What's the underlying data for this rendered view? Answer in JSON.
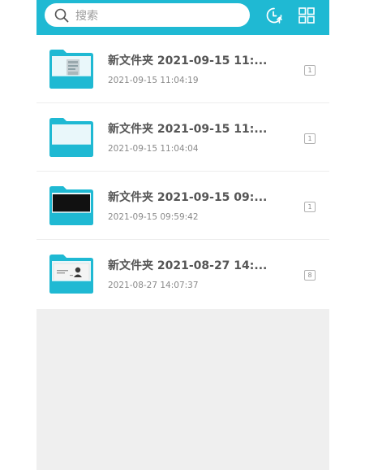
{
  "colors": {
    "accent": "#1fb9d3",
    "folder_light": "#e9f7fa",
    "background": "#efefef"
  },
  "header": {
    "search_placeholder": "搜索",
    "icons": [
      "search-icon",
      "clock-upload-icon",
      "grid-view-icon"
    ]
  },
  "folders": [
    {
      "title": "新文件夹 2021-09-15 11:...",
      "date": "2021-09-15 11:04:19",
      "count": "1",
      "thumbnail": "document-thumbnail"
    },
    {
      "title": "新文件夹 2021-09-15 11:...",
      "date": "2021-09-15 11:04:04",
      "count": "1",
      "thumbnail": "empty"
    },
    {
      "title": "新文件夹 2021-09-15 09:...",
      "date": "2021-09-15 09:59:42",
      "count": "1",
      "thumbnail": "dark-image-thumbnail"
    },
    {
      "title": "新文件夹 2021-08-27 14:...",
      "date": "2021-08-27 14:07:37",
      "count": "8",
      "thumbnail": "id-card-thumbnail"
    }
  ]
}
